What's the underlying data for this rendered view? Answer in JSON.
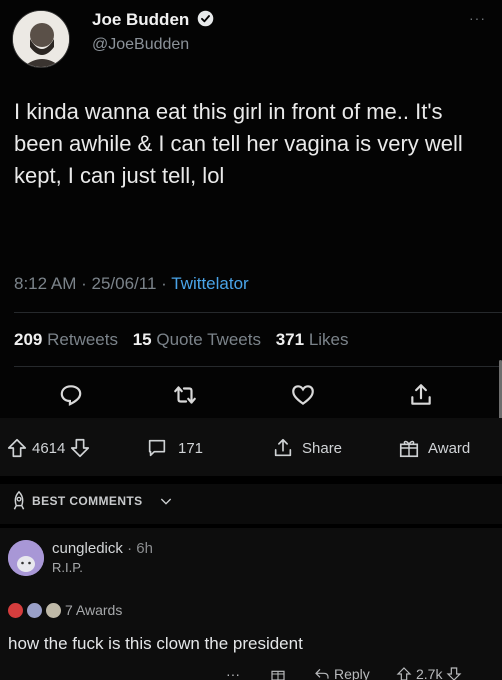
{
  "tweet": {
    "display_name": "Joe Budden",
    "handle": "@JoeBudden",
    "more": "···",
    "text": "I kinda wanna eat this girl in front of me.. It's been awhile & I can tell her vagina is very well kept, I can just tell, lol",
    "time": "8:12 AM",
    "date": "25/06/11",
    "source": "Twittelator",
    "retweets_count": "209",
    "retweets_label": "Retweets",
    "quote_count": "15",
    "quote_label": "Quote Tweets",
    "likes_count": "371",
    "likes_label": "Likes",
    "action_icons": [
      "reply-icon",
      "retweet-icon",
      "like-icon",
      "share-icon"
    ],
    "colors": {
      "accent": "#1d9bf0",
      "verified": "#e7e9ea"
    }
  },
  "reddit_post_bar": {
    "upvote_count": "4614",
    "comments_count": "171",
    "share_label": "Share",
    "award_label": "Award"
  },
  "sort": {
    "label": "BEST COMMENTS"
  },
  "comment": {
    "username": "cungledick",
    "dot": "·",
    "time": "6h",
    "flair": "R.I.P.",
    "awards_label": "7 Awards",
    "body": "how the fuck is this clown the president",
    "more": "···",
    "reply_label": "Reply",
    "score": "2.7k"
  }
}
